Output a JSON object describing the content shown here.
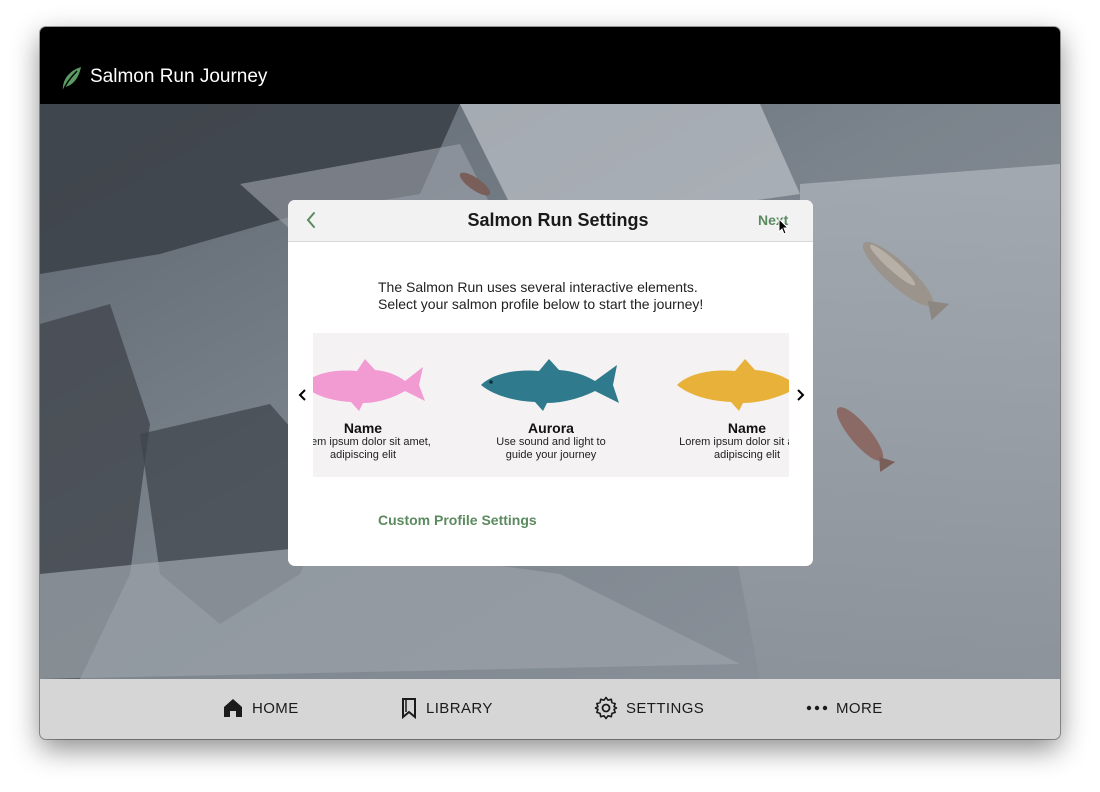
{
  "app": {
    "title": "Salmon Run Journey"
  },
  "modal": {
    "title": "Salmon Run Settings",
    "next_label": "Next",
    "intro_line1": "The Salmon Run uses several interactive elements.",
    "intro_line2": "Select your salmon profile below to start the journey!",
    "custom_link": "Custom Profile Settings",
    "profiles": [
      {
        "name": "Name",
        "line1": "Lorem ipsum dolor sit amet,",
        "line2": "adipiscing elit",
        "color": "#f29bd3"
      },
      {
        "name": "Aurora",
        "line1": "Use sound and light to",
        "line2": "guide your journey",
        "color": "#2f7a8c"
      },
      {
        "name": "Name",
        "line1": "Lorem ipsum dolor sit amet,",
        "line2": "adipiscing elit",
        "color": "#e8b23a"
      }
    ]
  },
  "nav": {
    "home": "HOME",
    "library": "LIBRARY",
    "settings": "SETTINGS",
    "more": "MORE"
  },
  "colors": {
    "accent_green": "#5b8a5f",
    "topbar": "#000000",
    "bottombar": "#d6d6d6",
    "leaf": "#5a9a63"
  },
  "icons": [
    "leaf-logo-icon",
    "chevron-left-icon",
    "chevron-right-icon",
    "home-icon",
    "bookmark-icon",
    "gear-icon",
    "more-dots-icon",
    "cursor-icon"
  ]
}
